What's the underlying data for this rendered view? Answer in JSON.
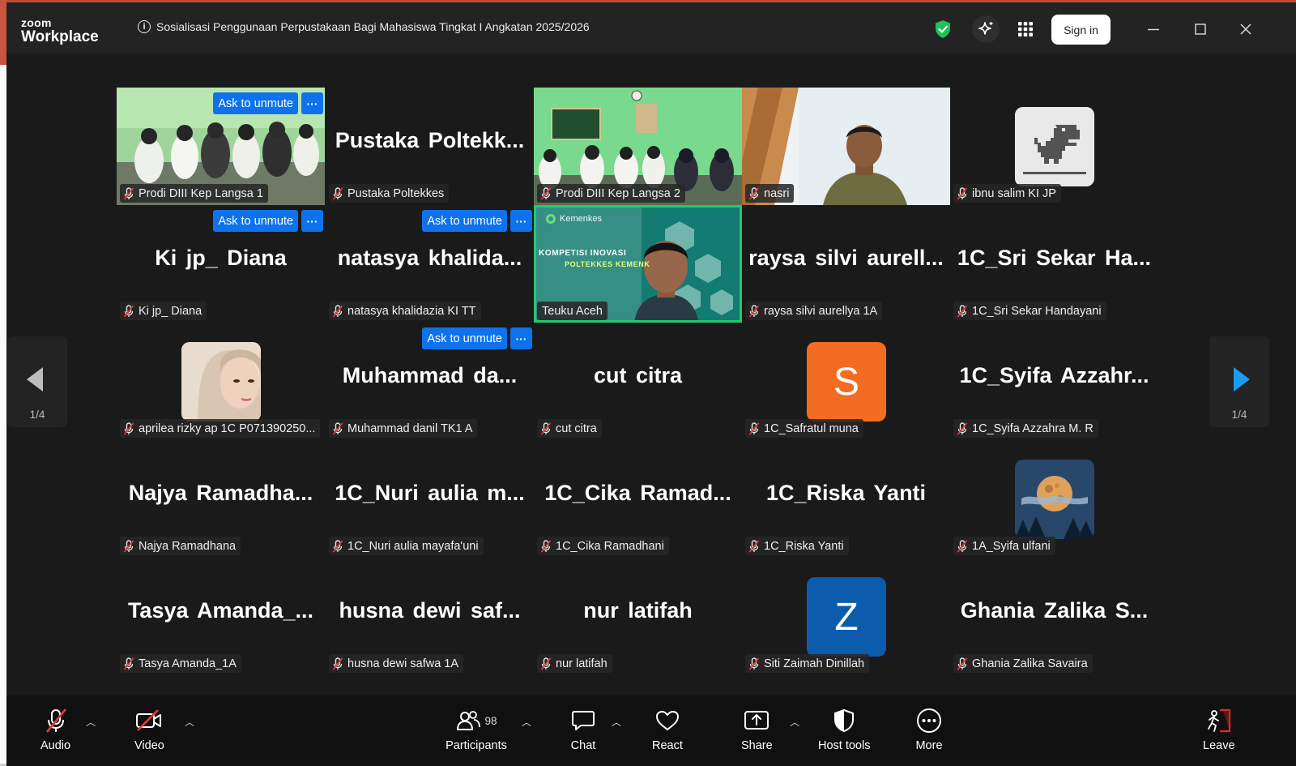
{
  "app": {
    "logo_top": "zoom",
    "logo_bottom": "Workplace"
  },
  "meeting": {
    "title": "Sosialisasi Penggunaan Perpustakaan Bagi Mahasiswa Tingkat I Angkatan 2025/2026"
  },
  "header": {
    "signin_label": "Sign in"
  },
  "action_labels": {
    "ask_unmute": "Ask to unmute",
    "more": "···"
  },
  "paging": {
    "left": "1/4",
    "right": "1/4"
  },
  "participants": [
    {
      "display": "",
      "tag": "Prodi DIII Kep Langsa 1",
      "kind": "video"
    },
    {
      "display": "Pustaka Poltekk...",
      "tag": "Pustaka Poltekkes",
      "kind": "name"
    },
    {
      "display": "",
      "tag": "Prodi DIII Kep Langsa 2",
      "kind": "video"
    },
    {
      "display": "",
      "tag": "nasri",
      "kind": "video"
    },
    {
      "display": "",
      "tag": "ibnu salim KI JP",
      "kind": "avatar-dino"
    },
    {
      "display": "Ki jp_ Diana",
      "tag": "Ki jp_ Diana",
      "kind": "name"
    },
    {
      "display": "natasya khalida...",
      "tag": "natasya khalidazia KI TT",
      "kind": "name"
    },
    {
      "display": "",
      "tag": "Teuku Aceh",
      "kind": "video-active",
      "banner_brand": "Kemenkes",
      "banner_text_1": "KOMPETISI INOVASI",
      "banner_text_2": "POLTEKKES KEMENK"
    },
    {
      "display": "raysa silvi aurell...",
      "tag": "raysa silvi aurellya 1A",
      "kind": "name"
    },
    {
      "display": "1C_Sri Sekar Ha...",
      "tag": "1C_Sri Sekar Handayani",
      "kind": "name"
    },
    {
      "display": "",
      "tag": "aprilea rizky ap 1C P071390250...",
      "kind": "avatar-photo"
    },
    {
      "display": "Muhammad da...",
      "tag": "Muhammad danil TK1 A",
      "kind": "name"
    },
    {
      "display": "cut citra",
      "tag": "cut citra",
      "kind": "name"
    },
    {
      "display": "S",
      "tag": "1C_Safratul muna",
      "kind": "avatar-letter",
      "color": "#f26d21"
    },
    {
      "display": "1C_Syifa Azzahr...",
      "tag": "1C_Syifa Azzahra M. R",
      "kind": "name"
    },
    {
      "display": "Najya Ramadha...",
      "tag": "Najya Ramadhana",
      "kind": "name"
    },
    {
      "display": "1C_Nuri aulia m...",
      "tag": "1C_Nuri aulia mayafa'uni",
      "kind": "name"
    },
    {
      "display": "1C_Cika Ramad...",
      "tag": "1C_Cika Ramadhani",
      "kind": "name"
    },
    {
      "display": "1C_Riska Yanti",
      "tag": "1C_Riska Yanti",
      "kind": "name"
    },
    {
      "display": "",
      "tag": "1A_Syifa ulfani",
      "kind": "avatar-moon"
    },
    {
      "display": "Tasya Amanda_...",
      "tag": "Tasya Amanda_1A",
      "kind": "name"
    },
    {
      "display": "husna dewi saf...",
      "tag": "husna dewi safwa 1A",
      "kind": "name"
    },
    {
      "display": "nur latifah",
      "tag": "nur latifah",
      "kind": "name"
    },
    {
      "display": "Z",
      "tag": "Siti Zaimah Dinillah",
      "kind": "avatar-letter",
      "color": "#0b5cad"
    },
    {
      "display": "Ghania Zalika S...",
      "tag": "Ghania Zalika Savaira",
      "kind": "name"
    }
  ],
  "toolbar": {
    "audio": "Audio",
    "video": "Video",
    "participants": "Participants",
    "participants_count": "98",
    "chat": "Chat",
    "react": "React",
    "share": "Share",
    "host_tools": "Host tools",
    "more": "More",
    "leave": "Leave"
  },
  "colors": {
    "accent_blue": "#0e72ed",
    "active_speaker": "#27c76f",
    "shield_green": "#20c05c",
    "leave_red": "#e02828"
  }
}
